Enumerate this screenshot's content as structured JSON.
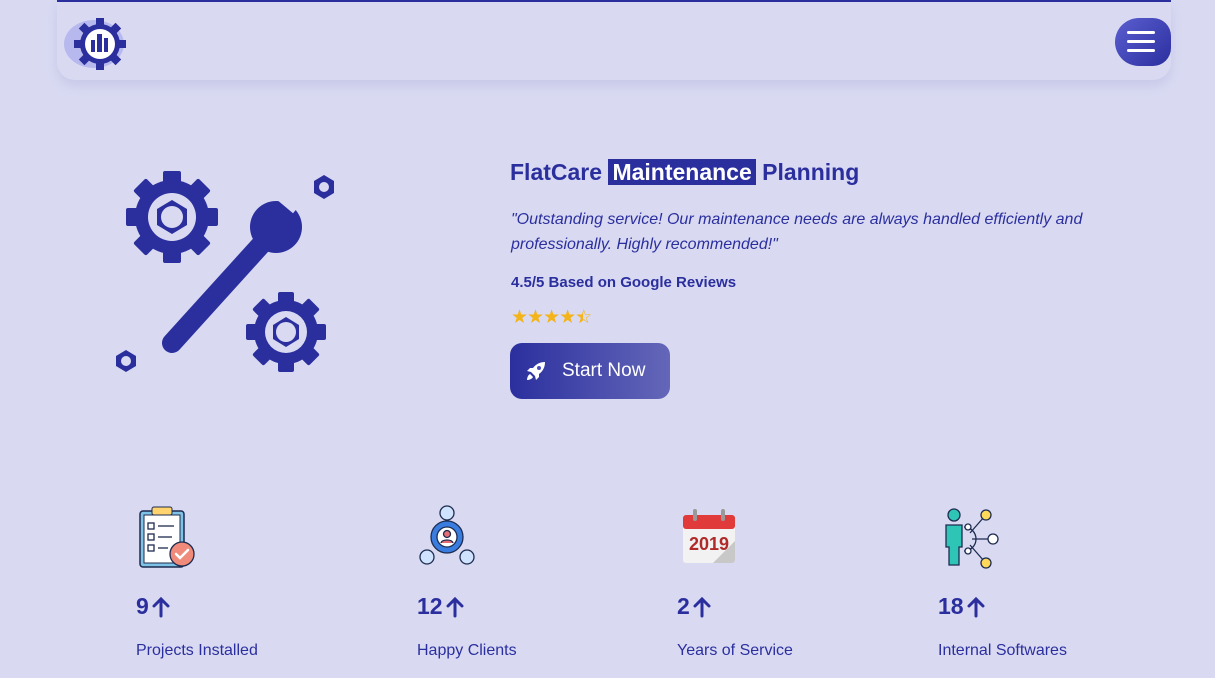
{
  "header": {
    "logo_icon": "gear-wrench-logo-icon",
    "menu_icon": "hamburger-menu-icon"
  },
  "hero": {
    "illustration_icon": "wrench-gears-icon",
    "title_pre": "FlatCare",
    "title_highlight": "Maintenance",
    "title_post": "Planning",
    "quote": "\"Outstanding service! Our maintenance needs are always handled efficiently and professionally. Highly recommended!\"",
    "rating_text": "4.5/5 Based on Google Reviews",
    "rating_value": 4.5,
    "rating_max": 5,
    "cta_label": "Start Now",
    "cta_icon": "rocket-icon"
  },
  "stats": [
    {
      "icon": "clipboard-checklist-icon",
      "value": "9",
      "label": "Projects Installed"
    },
    {
      "icon": "team-network-icon",
      "value": "12",
      "label": "Happy Clients"
    },
    {
      "icon": "calendar-icon",
      "value": "2",
      "label": "Years of Service"
    },
    {
      "icon": "person-network-icon",
      "value": "18",
      "label": "Internal Softwares"
    }
  ],
  "colors": {
    "background": "#d9daf2",
    "primary": "#2b2f9e",
    "star": "#f3b319"
  }
}
